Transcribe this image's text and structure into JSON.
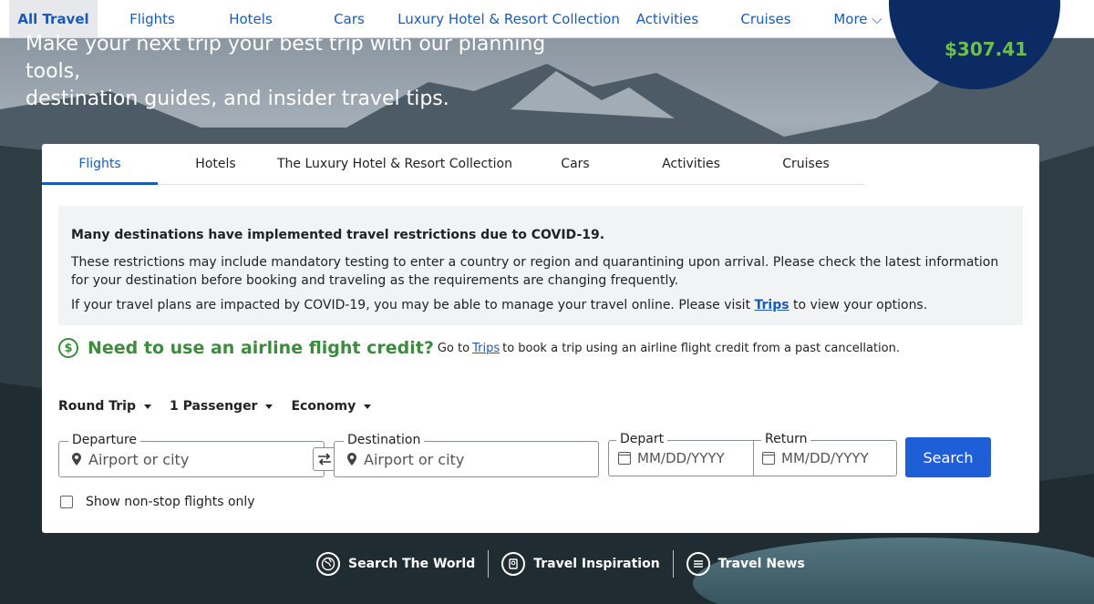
{
  "top_nav": {
    "items": [
      {
        "label": "All Travel",
        "active": true
      },
      {
        "label": "Flights"
      },
      {
        "label": "Hotels"
      },
      {
        "label": "Cars"
      },
      {
        "label": "Luxury Hotel & Resort Collection"
      },
      {
        "label": "Activities"
      },
      {
        "label": "Cruises"
      },
      {
        "label": "More ⌵"
      }
    ]
  },
  "hero": {
    "line1": "Make your next trip your best trip with our planning tools,",
    "line2": "destination guides, and insider travel tips.",
    "badge_value": "$307.41"
  },
  "search_tabs": {
    "items": [
      {
        "label": "Flights",
        "active": true
      },
      {
        "label": "Hotels"
      },
      {
        "label": "The Luxury Hotel & Resort Collection"
      },
      {
        "label": "Cars"
      },
      {
        "label": "Activities"
      },
      {
        "label": "Cruises"
      }
    ]
  },
  "notice": {
    "title": "Many destinations have implemented travel restrictions due to COVID-19.",
    "para1": "These restrictions may include mandatory testing to enter a country or region and quarantining upon arrival. Please check the latest information for your destination before booking and traveling as the requirements are changing frequently.",
    "para2_before": "If your travel plans are impacted by COVID-19, you may be able to manage your travel online. Please visit ",
    "para2_link": "Trips",
    "para2_after": " to view your options."
  },
  "credit": {
    "icon": "dollar-circle-icon",
    "title": "Need to use an airline flight credit?",
    "text_before": "Go to",
    "link": "Trips",
    "text_after": "to book a trip using an airline flight credit from a past cancellation."
  },
  "options": {
    "trip_type": "Round Trip",
    "passengers": "1 Passenger",
    "cabin": "Economy"
  },
  "fields": {
    "departure_label": "Departure",
    "departure_placeholder": "Airport or city",
    "destination_label": "Destination",
    "destination_placeholder": "Airport or city",
    "depart_label": "Depart",
    "depart_placeholder": "MM/DD/YYYY",
    "return_label": "Return",
    "return_placeholder": "MM/DD/YYYY"
  },
  "search_button": "Search",
  "nonstop_label": "Show non-stop flights only",
  "bottom_links": [
    {
      "label": "Search The World",
      "icon": "globe-icon"
    },
    {
      "label": "Travel Inspiration",
      "icon": "passport-icon"
    },
    {
      "label": "Travel News",
      "icon": "news-icon"
    }
  ],
  "colors": {
    "primary_blue": "#1e5fd8",
    "link_blue": "#1a5bb8",
    "credit_green": "#3d8b3d",
    "badge_navy": "#0c2b63",
    "badge_green": "#6cc04a"
  }
}
